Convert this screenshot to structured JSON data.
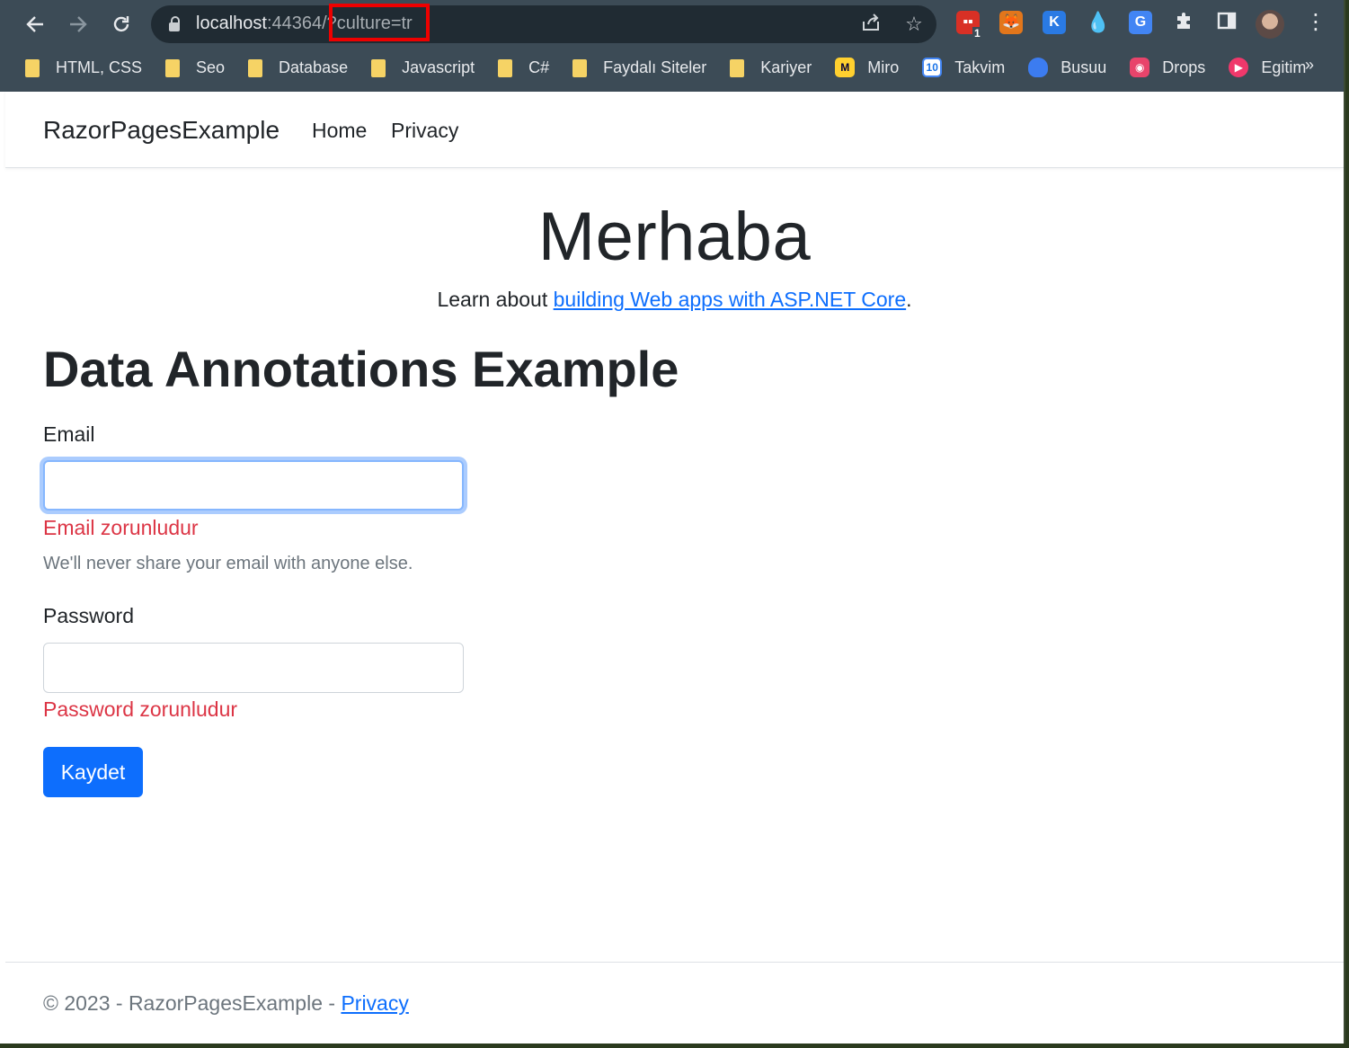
{
  "browser": {
    "url_host": "localhost",
    "url_port": ":44364/",
    "url_query": "?culture=tr",
    "extension_badge": "1",
    "bookmarks": [
      {
        "label": "HTML, CSS",
        "icon": "folder-icon"
      },
      {
        "label": "Seo",
        "icon": "folder-icon"
      },
      {
        "label": "Database",
        "icon": "folder-icon"
      },
      {
        "label": "Javascript",
        "icon": "folder-icon"
      },
      {
        "label": "C#",
        "icon": "folder-icon"
      },
      {
        "label": "Faydalı Siteler",
        "icon": "folder-icon"
      },
      {
        "label": "Kariyer",
        "icon": "folder-icon"
      },
      {
        "label": "Miro",
        "icon": "miro-icon"
      },
      {
        "label": "Takvim",
        "icon": "calendar-icon"
      },
      {
        "label": "Busuu",
        "icon": "busuu-icon"
      },
      {
        "label": "Drops",
        "icon": "drops-icon"
      },
      {
        "label": "Egitim",
        "icon": "play-icon"
      }
    ],
    "more_bookmarks": "»",
    "calendar_day": "10"
  },
  "navbar": {
    "brand": "RazorPagesExample",
    "links": [
      "Home",
      "Privacy"
    ]
  },
  "hero": {
    "title": "Merhaba",
    "learn_prefix": "Learn about ",
    "learn_link": "building Web apps with ASP.NET Core",
    "learn_suffix": "."
  },
  "form": {
    "title": "Data Annotations Example",
    "email_label": "Email",
    "email_value": "",
    "email_error": "Email zorunludur",
    "email_help": "We'll never share your email with anyone else.",
    "password_label": "Password",
    "password_value": "",
    "password_error": "Password zorunludur",
    "submit_label": "Kaydet"
  },
  "footer": {
    "text": "© 2023 - RazorPagesExample - ",
    "link": "Privacy"
  },
  "colors": {
    "primary": "#0d6efd",
    "error": "#dc3545",
    "highlight": "#ee0000"
  }
}
